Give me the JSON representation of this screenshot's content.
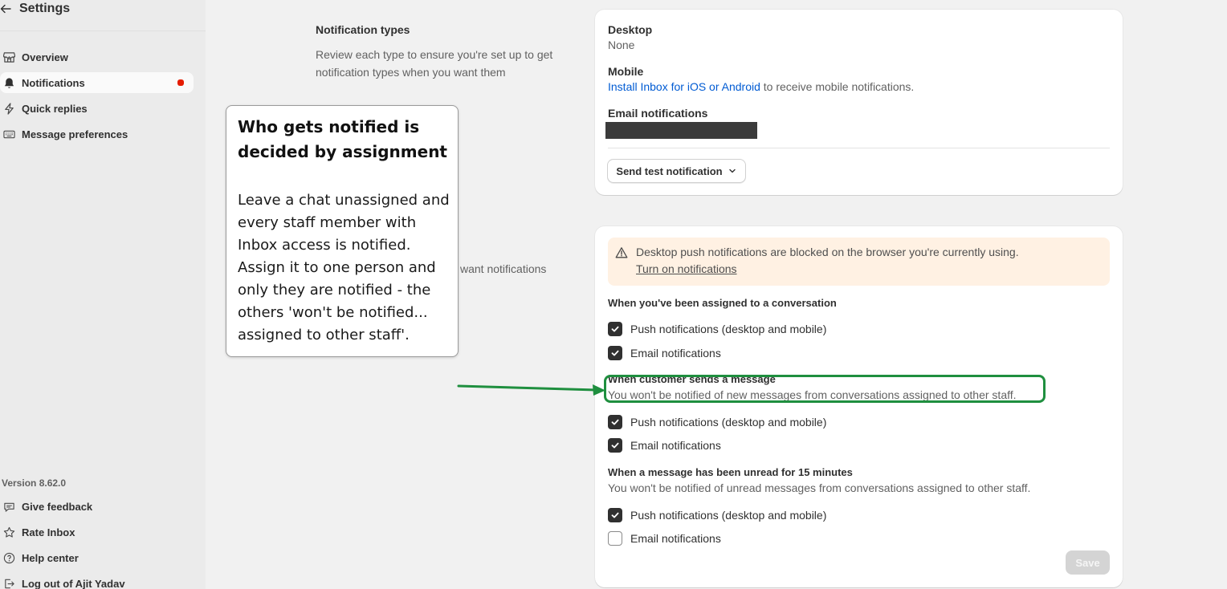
{
  "sidebar": {
    "title": "Settings",
    "nav": [
      {
        "label": "Overview",
        "icon": "store-icon"
      },
      {
        "label": "Notifications",
        "icon": "bell-icon"
      },
      {
        "label": "Quick replies",
        "icon": "lightning-icon"
      },
      {
        "label": "Message preferences",
        "icon": "keyboard-icon"
      }
    ],
    "version": "Version 8.62.0",
    "footer": [
      {
        "label": "Give feedback",
        "icon": "chat-bubble-icon"
      },
      {
        "label": "Rate Inbox",
        "icon": "star-icon"
      },
      {
        "label": "Help center",
        "icon": "help-circle-icon"
      },
      {
        "label": "Log out of Ajit Yadav",
        "icon": "logout-icon"
      }
    ]
  },
  "types_section": {
    "title": "Notification types",
    "description": "Review each type to ensure you're set up to get notification types when you want them",
    "description2": "want notifications"
  },
  "card1": {
    "desktop_label": "Desktop",
    "desktop_value": "None",
    "mobile_label": "Mobile",
    "mobile_link": "Install Inbox for iOS or Android",
    "mobile_suffix": "to receive mobile notifications.",
    "email_label": "Email notifications",
    "test_button": "Send test notification"
  },
  "card2": {
    "banner_text": "Desktop push notifications are blocked on the browser you're currently using.",
    "banner_link": "Turn on notifications",
    "groups": [
      {
        "title": "When you've been assigned to a conversation",
        "subtitle": "",
        "push": {
          "label": "Push notifications (desktop and mobile)",
          "checked": true
        },
        "email": {
          "label": "Email notifications",
          "checked": true
        }
      },
      {
        "title": "When customer sends a message",
        "subtitle": "You won't be notified of new messages from conversations assigned to other staff.",
        "push": {
          "label": "Push notifications (desktop and mobile)",
          "checked": true
        },
        "email": {
          "label": "Email notifications",
          "checked": true
        }
      },
      {
        "title": "When a message has been unread for 15 minutes",
        "subtitle": "You won't be notified of unread messages from conversations assigned to other staff.",
        "push": {
          "label": "Push notifications (desktop and mobile)",
          "checked": true
        },
        "email": {
          "label": "Email notifications",
          "checked": false
        }
      }
    ],
    "save_button": "Save"
  },
  "annotation": {
    "title": "Who gets notified is decided by assignment",
    "body": "Leave a chat unassigned and every staff member with Inbox access is notified. Assign it to one person and only they are notified - the others 'won't be notified... assigned to other staff'.",
    "highlight_color": "#1f8f3f"
  },
  "colors": {
    "link": "#005bd3",
    "banner_bg": "#fff1e3",
    "active_dot": "#e51c00"
  }
}
